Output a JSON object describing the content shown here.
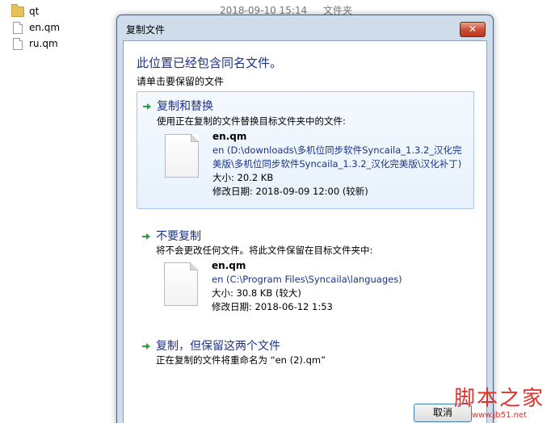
{
  "explorer": {
    "files": [
      {
        "name": "qt",
        "kind": "folder"
      },
      {
        "name": "en.qm",
        "kind": "file"
      },
      {
        "name": "ru.qm",
        "kind": "file"
      }
    ],
    "row_meta": {
      "date": "2018-09-10 15:14",
      "type": "文件夹"
    }
  },
  "dialog": {
    "title": "复制文件",
    "close_label": "✕",
    "heading": "此位置已经包含同名文件。",
    "subheading": "请单击要保留的文件",
    "options": [
      {
        "title": "复制和替换",
        "description": "使用正在复制的文件替换目标文件夹中的文件:",
        "file": {
          "name": "en.qm",
          "path_line1": "en (D:\\downloads\\多机位同步软件Syncaila_1.3.2_汉化完",
          "path_line2": "美版\\多机位同步软件Syncaila_1.3.2_汉化完美版\\汉化补丁)",
          "size": "大小: 20.2 KB",
          "modified": "修改日期: 2018-09-09 12:00 (较新)"
        }
      },
      {
        "title": "不要复制",
        "description": "将不会更改任何文件。将此文件保留在目标文件夹中:",
        "file": {
          "name": "en.qm",
          "path_line1": "en (C:\\Program Files\\Syncaila\\languages)",
          "size": "大小: 30.8 KB (较大)",
          "modified": "修改日期: 2018-06-12 1:53"
        }
      },
      {
        "title": "复制，但保留这两个文件",
        "description": "正在复制的文件将重命名为 “en (2).qm”"
      }
    ],
    "cancel_label": "取消"
  },
  "watermark": {
    "text": "脚本之家",
    "url": "www.jb51.net"
  },
  "colors": {
    "accent_text": "#1e3287",
    "arrow": "#2f9e3a",
    "highlight_border": "#a9c6e5",
    "watermark": "#e0332a"
  }
}
